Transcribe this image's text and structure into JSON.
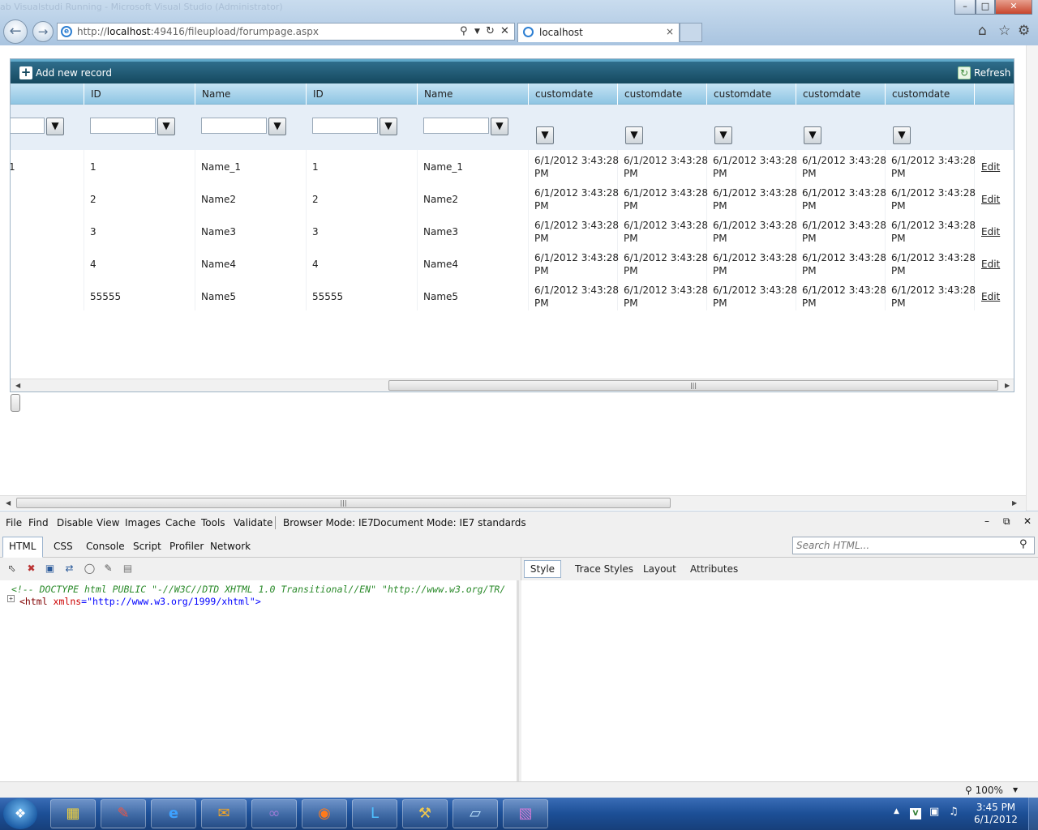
{
  "window": {
    "ghost_title": "ab Visualstudi Running - Microsoft Visual Studio (Administrator)",
    "controls": [
      "–",
      "□",
      "✕"
    ]
  },
  "browser": {
    "url_prefix": "http://",
    "url_host": "localhost",
    "url_rest": ":49416/fileupload/forumpage.aspx",
    "tab_label": "localhost",
    "tab_close": "×"
  },
  "grid": {
    "add_label": "Add new record",
    "refresh_label": "Refresh",
    "headers": [
      "",
      "ID",
      "Name",
      "ID",
      "Name",
      "customdate",
      "customdate",
      "customdate",
      "customdate",
      "customdate",
      ""
    ],
    "rows": [
      {
        "c0": "1",
        "id1": "1",
        "name1": "Name_1",
        "id2": "1",
        "name2": "Name_1",
        "d1": "6/1/2012 3:43:28",
        "d1b": "PM",
        "d2": "6/1/2012 3:43:28",
        "d2b": "PM",
        "d3": "6/1/2012 3:43:28",
        "d3b": "PM",
        "d4": "6/1/2012 3:43:28",
        "d4b": "PM",
        "d5": "6/1/2012 3:43:28",
        "d5b": "PM",
        "edit": "Edit"
      },
      {
        "c0": "",
        "id1": "2",
        "name1": "Name2",
        "id2": "2",
        "name2": "Name2",
        "d1": "6/1/2012 3:43:28",
        "d1b": "PM",
        "d2": "6/1/2012 3:43:28",
        "d2b": "PM",
        "d3": "6/1/2012 3:43:28",
        "d3b": "PM",
        "d4": "6/1/2012 3:43:28",
        "d4b": "PM",
        "d5": "6/1/2012 3:43:28",
        "d5b": "PM",
        "edit": "Edit"
      },
      {
        "c0": "",
        "id1": "3",
        "name1": "Name3",
        "id2": "3",
        "name2": "Name3",
        "d1": "6/1/2012 3:43:28",
        "d1b": "PM",
        "d2": "6/1/2012 3:43:28",
        "d2b": "PM",
        "d3": "6/1/2012 3:43:28",
        "d3b": "PM",
        "d4": "6/1/2012 3:43:28",
        "d4b": "PM",
        "d5": "6/1/2012 3:43:28",
        "d5b": "PM",
        "edit": "Edit"
      },
      {
        "c0": "",
        "id1": "4",
        "name1": "Name4",
        "id2": "4",
        "name2": "Name4",
        "d1": "6/1/2012 3:43:28",
        "d1b": "PM",
        "d2": "6/1/2012 3:43:28",
        "d2b": "PM",
        "d3": "6/1/2012 3:43:28",
        "d3b": "PM",
        "d4": "6/1/2012 3:43:28",
        "d4b": "PM",
        "d5": "6/1/2012 3:43:28",
        "d5b": "PM",
        "edit": "Edit"
      },
      {
        "c0": "",
        "id1": "55555",
        "name1": "Name5",
        "id2": "55555",
        "name2": "Name5",
        "d1": "6/1/2012 3:43:28",
        "d1b": "PM",
        "d2": "6/1/2012 3:43:28",
        "d2b": "PM",
        "d3": "6/1/2012 3:43:28",
        "d3b": "PM",
        "d4": "6/1/2012 3:43:28",
        "d4b": "PM",
        "d5": "6/1/2012 3:43:28",
        "d5b": "PM",
        "edit": "Edit"
      }
    ]
  },
  "devtools": {
    "menu": [
      "File",
      "Find",
      "Disable",
      "View",
      "Images",
      "Cache",
      "Tools",
      "Validate"
    ],
    "browser_mode": "Browser Mode: IE7",
    "document_mode": "Document Mode: IE7 standards",
    "tabs": [
      "HTML",
      "CSS",
      "Console",
      "Script",
      "Profiler",
      "Network"
    ],
    "search_placeholder": "Search HTML...",
    "style_tabs": [
      "Style",
      "Trace Styles",
      "Layout",
      "Attributes"
    ],
    "tree": {
      "doctype": "<!-- DOCTYPE html PUBLIC \"-//W3C//DTD XHTML 1.0 Transitional//EN\" \"http://www.w3.org/TR/",
      "html_open": "<html ",
      "attr_name": "xmlns",
      "attr_eq": "=\"",
      "attr_value": "http://www.w3.org/1999/xhtml",
      "html_close": "\">"
    },
    "zoom": "100%"
  },
  "taskbar": {
    "time": "3:45 PM",
    "date": "6/1/2012"
  },
  "colors": {
    "grid_command_bar": "#15495f",
    "grid_header": "#a9d4ec",
    "link": "#1f5fb5"
  }
}
